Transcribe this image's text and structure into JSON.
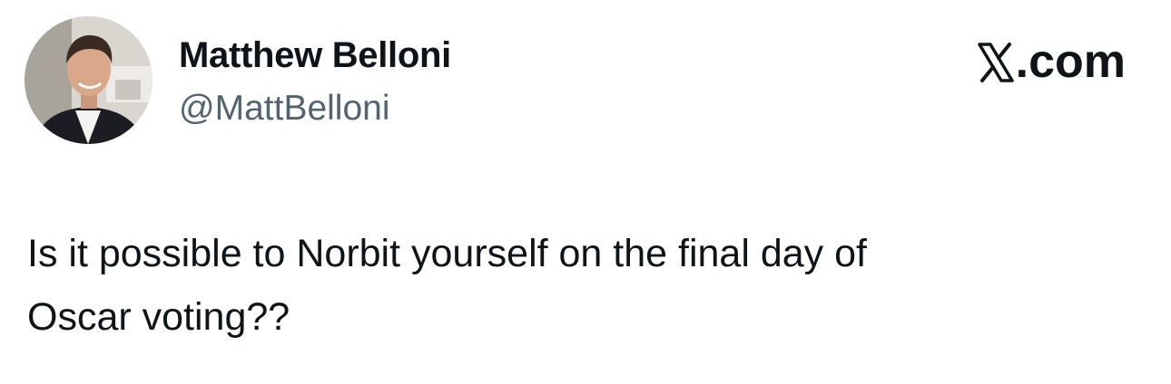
{
  "author": {
    "display_name": "Matthew Belloni",
    "handle": "@MattBelloni",
    "avatar_icon": "profile-photo"
  },
  "brand": {
    "icon": "x-logo-icon",
    "suffix": ".com"
  },
  "tweet": {
    "text": "Is it possible to Norbit yourself on the final day of\nOscar voting??"
  },
  "colors": {
    "text_primary": "#0f1419",
    "text_secondary": "#536471",
    "background": "#ffffff"
  }
}
